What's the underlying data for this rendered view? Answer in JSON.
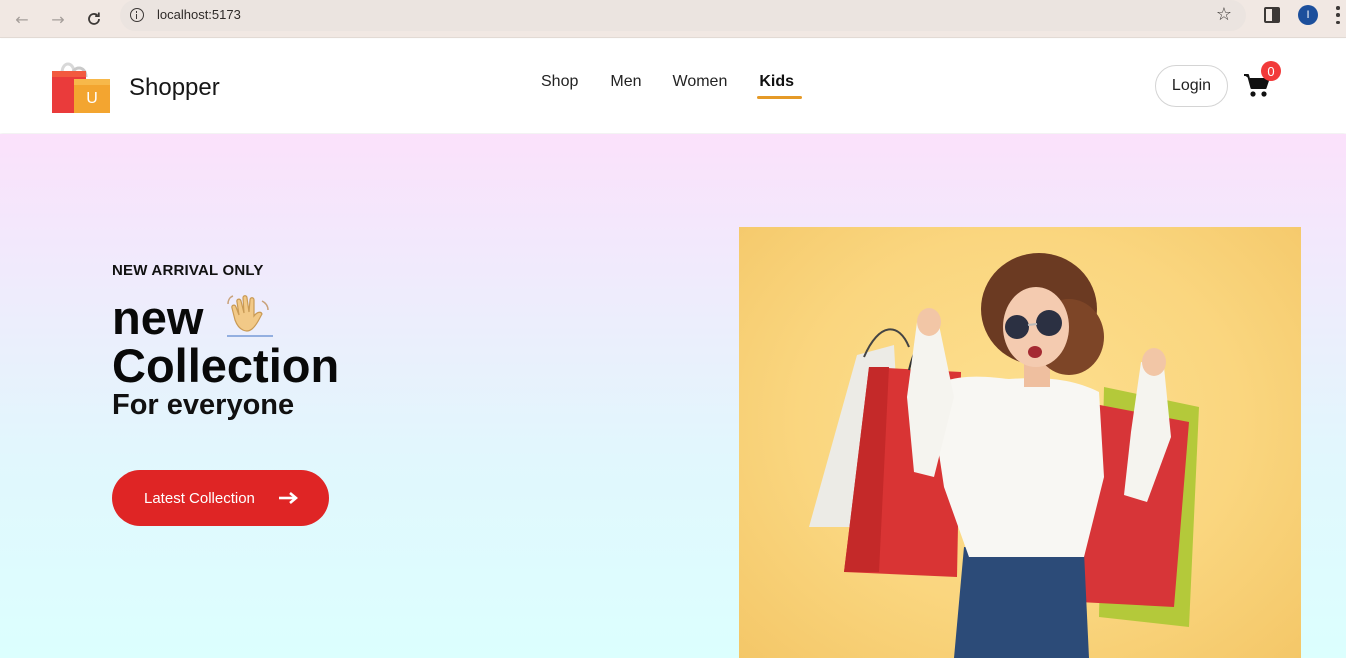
{
  "browser": {
    "url": "localhost:5173",
    "profile_initial": "I"
  },
  "navbar": {
    "brand": "Shopper",
    "menu": [
      {
        "label": "Shop",
        "active": false
      },
      {
        "label": "Men",
        "active": false
      },
      {
        "label": "Women",
        "active": false
      },
      {
        "label": "Kids",
        "active": true
      }
    ],
    "login_label": "Login",
    "cart_count": "0"
  },
  "hero": {
    "tagline": "NEW ARRIVAL ONLY",
    "line1": "new",
    "line2": "Collection",
    "line3": "For everyone",
    "cta_label": "Latest Collection"
  },
  "colors": {
    "accent_red": "#df2525",
    "active_underline": "#e59a27",
    "image_bg": "#fad67f"
  }
}
